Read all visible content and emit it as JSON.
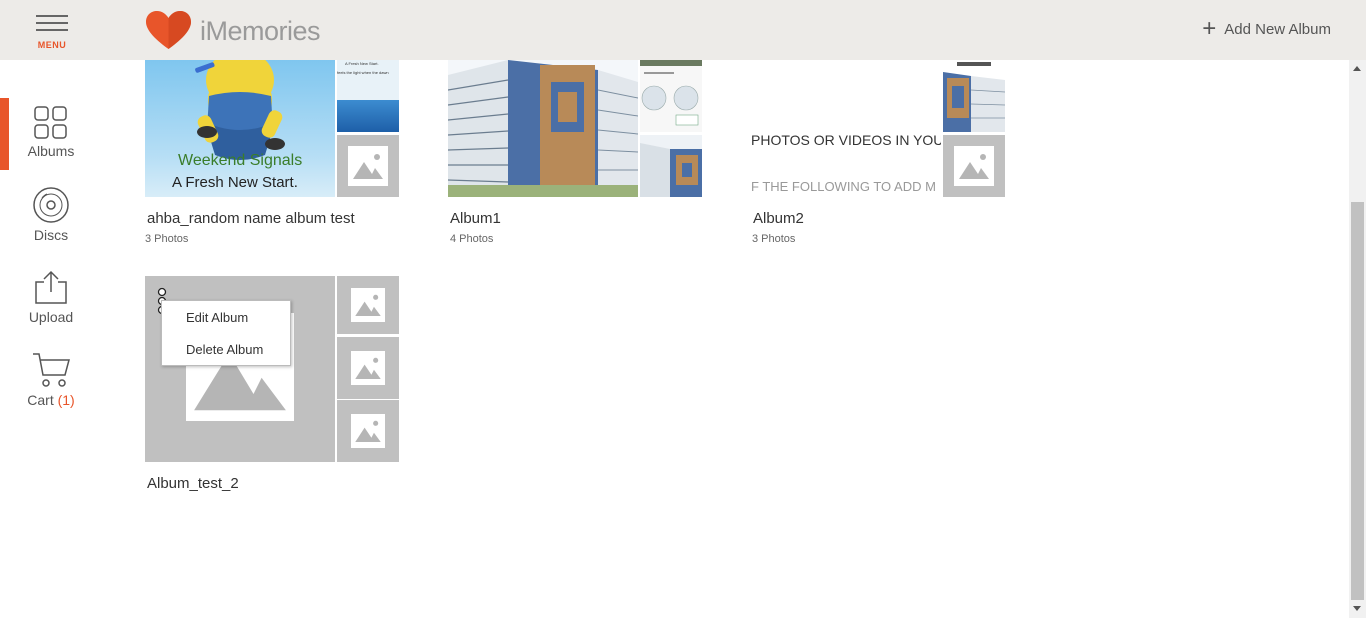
{
  "header": {
    "menu_label": "MENU",
    "logo_text": "iMemories",
    "add_album_label": "Add New Album",
    "accent_color": "#e8552a"
  },
  "sidebar": {
    "items": [
      {
        "label": "Albums",
        "icon": "grid-icon",
        "active": true
      },
      {
        "label": "Discs",
        "icon": "disc-icon"
      },
      {
        "label": "Upload",
        "icon": "upload-icon"
      },
      {
        "label": "Cart",
        "count": "(1)",
        "icon": "cart-icon"
      }
    ]
  },
  "albums": [
    {
      "title": "ahba_random name album test",
      "count": "3 Photos",
      "cover_text": [
        "Weekend Signals",
        "A Fresh New Start."
      ],
      "thumb1_text": [
        "A Fresh New Start.",
        "feels the light when the dawn"
      ]
    },
    {
      "title": "Album1",
      "count": "4 Photos"
    },
    {
      "title": "Album2",
      "count": "3 Photos",
      "cover_text": [
        "PHOTOS OR VIDEOS IN YOUR",
        "F THE FOLLOWING TO ADD M"
      ]
    },
    {
      "title": "Album_test_2",
      "count": ""
    }
  ],
  "context_menu": {
    "items": [
      "Edit Album",
      "Delete Album"
    ]
  }
}
